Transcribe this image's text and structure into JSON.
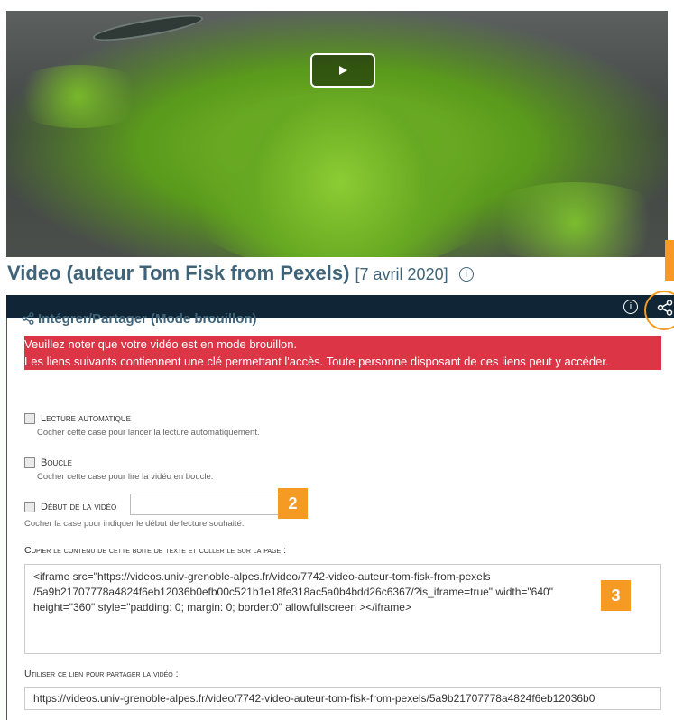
{
  "video": {
    "play_icon": "play-icon"
  },
  "title": {
    "main": "Video (auteur Tom Fisk from Pexels)",
    "date": "[7 avril 2020]",
    "info_icon": "info-icon"
  },
  "toolbar": {
    "info_icon": "info-icon",
    "share_icon": "share-icon"
  },
  "panel": {
    "title": "Intégrer/Partager (Mode brouillon)",
    "alert_line1": "Veuillez noter que votre vidéo est en mode brouillon.",
    "alert_line2": "Les liens suivants contiennent une clé permettant l'accès. Toute personne disposant de ces liens peut y accéder."
  },
  "options": {
    "autoplay": {
      "label": "Lecture automatique",
      "help": "Cocher cette case pour lancer la lecture automatiquement."
    },
    "loop": {
      "label": "Boucle",
      "help": "Cocher cette case pour lire la vidéo en boucle."
    },
    "start": {
      "label": "Début de la vidéo",
      "value": "",
      "help": "Cocher la case pour indiquer le début de lecture souhaité."
    }
  },
  "embed": {
    "label": "Copier le contenu de cette boite de texte et coller le sur la page :",
    "line1": "<iframe src=\"https://videos.univ-grenoble-alpes.fr/video/7742-video-auteur-tom-fisk-from-pexels",
    "line2": "/5a9b21707778a4824f6eb12036b0efb00c521b1e18fe318ac5a0b4bdd26c6367/?is_iframe=true\" width=\"640\"",
    "line3": "height=\"360\" style=\"padding: 0; margin: 0; border:0\" allowfullscreen ></iframe>"
  },
  "share": {
    "label": "Utiliser ce lien pour partager la vidéo :",
    "url": "https://videos.univ-grenoble-alpes.fr/video/7742-video-auteur-tom-fisk-from-pexels/5a9b21707778a4824f6eb12036b0"
  },
  "badges": {
    "b2": "2",
    "b3": "3"
  },
  "colors": {
    "accent": "#f59a23",
    "alert": "#dc3545",
    "bar": "#102535",
    "title": "#3f6479"
  }
}
